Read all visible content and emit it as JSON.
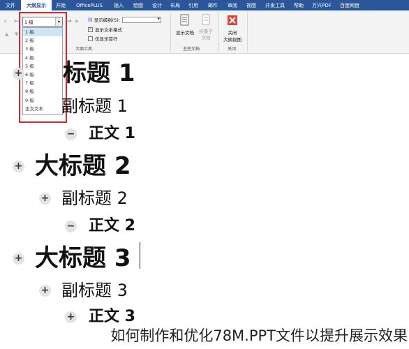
{
  "ribbon": {
    "tabs": [
      "文件",
      "大纲显示",
      "开始",
      "OfficePLUS",
      "插入",
      "绘图",
      "设计",
      "布局",
      "引用",
      "邮件",
      "审阅",
      "视图",
      "开发工具",
      "帮助",
      "万兴PDF",
      "百度网盘"
    ],
    "active_tab": "大纲显示",
    "outline_tools": {
      "level_value": "1 级",
      "show_level_label": "显示级别(S):",
      "show_text_format_label": "显示文本格式",
      "show_text_format_checked": "✓",
      "show_first_line_only_label": "仅显示首行",
      "group_label": "大纲工具"
    },
    "master_document": {
      "show_document_label": "显示文档",
      "collapse_subdocuments_label": "折叠子文档",
      "group_label": "主控文档"
    },
    "close": {
      "label_line1": "关闭",
      "label_line2": "大纲视图",
      "group_label": "关闭"
    }
  },
  "level_dropdown": {
    "options": [
      "1 级",
      "2 级",
      "3 级",
      "4 级",
      "5 级",
      "6 级",
      "7 级",
      "8 级",
      "9 级",
      "正文文本"
    ],
    "selected_index": 0
  },
  "outline": [
    {
      "level": "h1",
      "text": "标题 1",
      "bullet": "+"
    },
    {
      "level": "h2",
      "text": "副标题 1",
      "bullet": ""
    },
    {
      "level": "body",
      "text": "正文 1",
      "bullet": "−"
    },
    {
      "level": "h1",
      "text": "大标题 2",
      "bullet": "+"
    },
    {
      "level": "h2",
      "text": "副标题 2",
      "bullet": "+"
    },
    {
      "level": "body",
      "text": "正文 2",
      "bullet": "−"
    },
    {
      "level": "h1",
      "text": "大标题 3",
      "bullet": "+"
    },
    {
      "level": "h2",
      "text": "副标题 3",
      "bullet": "+"
    },
    {
      "level": "body",
      "text": "正文 3",
      "bullet": "+"
    }
  ],
  "caption": "如何制作和优化78M.PPT文件以提升展示效果",
  "colors": {
    "ribbon_blue": "#2b579a",
    "highlight_red": "#d9262c",
    "close_red": "#d9443a",
    "dropdown_selected": "#cde6f7"
  },
  "icons": {
    "promote_to_heading1": "double-left-arrow-icon",
    "promote": "left-arrow-icon",
    "demote": "right-arrow-icon",
    "demote_to_body": "double-right-arrow-icon",
    "move_up": "up-triangle-icon",
    "move_down": "down-triangle-icon",
    "expand": "plus-circle-icon",
    "collapse": "minus-circle-icon",
    "close": "close-x-icon"
  }
}
